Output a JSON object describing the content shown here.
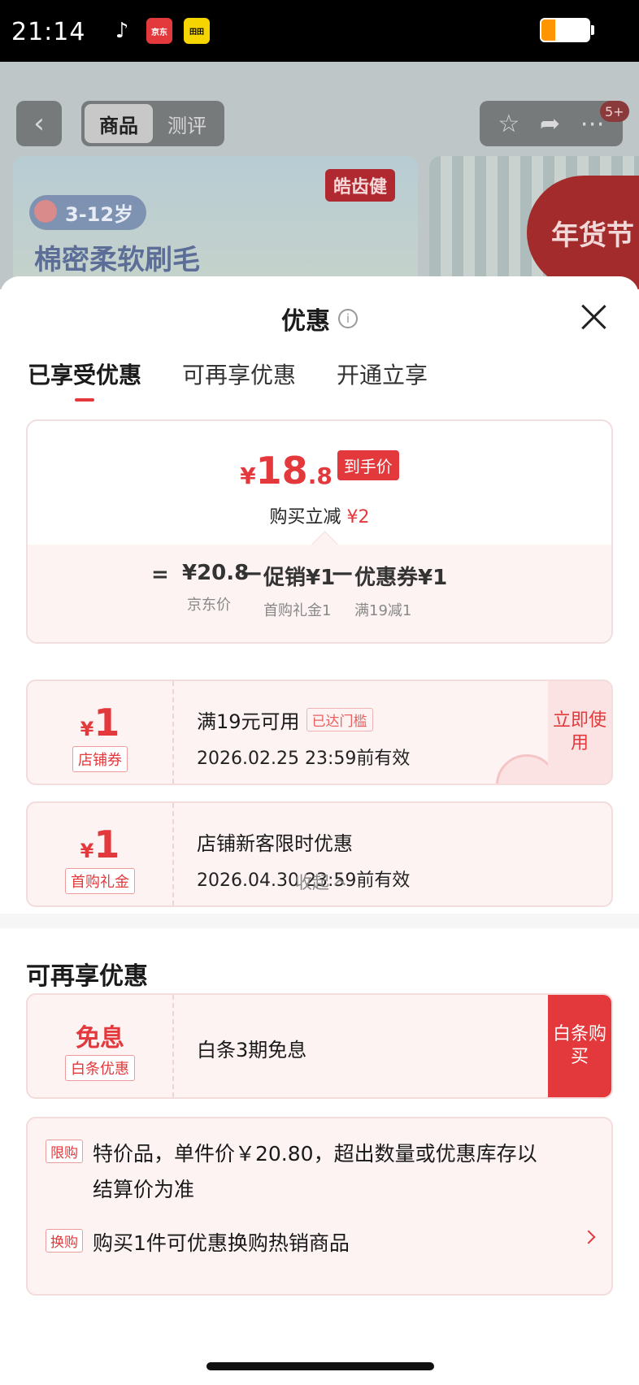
{
  "status_bar": {
    "time": "21:14",
    "apps": [
      "TikTok",
      "京东",
      "田田"
    ]
  },
  "behind": {
    "tabs": [
      "商品",
      "测评"
    ],
    "badge": "5+",
    "brand": "皓齿健",
    "age": "3-12岁",
    "title": "棉密柔软刷毛",
    "festival": "年货节"
  },
  "sheet": {
    "title": "优惠",
    "tabs": [
      "已享受优惠",
      "可再享优惠",
      "开通立享"
    ]
  },
  "price": {
    "currency": "¥",
    "integer": "18",
    "decimal": ".8",
    "tag": "到手价",
    "instant_label": "购买立减",
    "instant_value": "¥2",
    "calc": {
      "eq": "=",
      "items": [
        {
          "main": "¥20.8",
          "sub": "京东价"
        },
        {
          "main": "促销¥1",
          "sub": "首购礼金1"
        },
        {
          "main": "优惠券¥1",
          "sub": "满19减1"
        }
      ],
      "op": "—"
    }
  },
  "coupons": [
    {
      "currency": "¥",
      "amount": "1",
      "tag": "店铺券",
      "line1": "满19元可用",
      "badge": "已达门槛",
      "line2": "2026.02.25 23:59前有效",
      "action": "立即使用"
    },
    {
      "currency": "¥",
      "amount": "1",
      "tag": "首购礼金",
      "line1": "店铺新客限时优惠",
      "line2": "2026.04.30 23:59前有效"
    }
  ],
  "collapse": "收起",
  "section2": {
    "title": "可再享优惠",
    "baitiao": {
      "big": "免息",
      "tag": "白条优惠",
      "text": "白条3期免息",
      "action": "白条购买"
    }
  },
  "rules": [
    {
      "tag": "限购",
      "text": "特价品，单件价￥20.80，超出数量或优惠库存以结算价为准"
    },
    {
      "tag": "换购",
      "text": "购买1件可优惠换购热销商品"
    }
  ],
  "colors": {
    "accent": "#e4393c",
    "card_bg": "#fdf3f3",
    "battery": "#ff9500"
  },
  "battery_level": 0.3
}
